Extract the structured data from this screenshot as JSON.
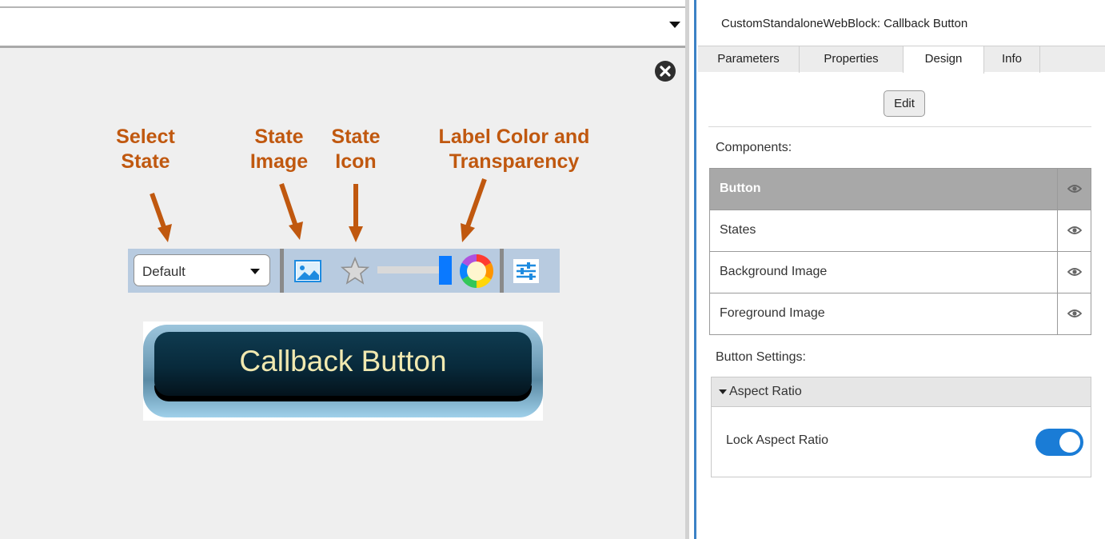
{
  "annotations": {
    "select_state": [
      "Select",
      "State"
    ],
    "state_image": [
      "State",
      "Image"
    ],
    "state_icon": [
      "State",
      "Icon"
    ],
    "label_color": [
      "Label Color and",
      "Transparency"
    ]
  },
  "toolbar": {
    "state_value": "Default",
    "image_icon": "image-icon",
    "star_icon": "star-icon",
    "color_wheel_icon": "color-wheel-icon",
    "settings_icon": "sliders-icon",
    "slider_level": 1.0
  },
  "callback_button": {
    "label": "Callback Button",
    "text_color": "#f1e9b0"
  },
  "panel": {
    "title": "CustomStandaloneWebBlock: Callback Button",
    "tabs": [
      {
        "label": "Parameters",
        "active": false
      },
      {
        "label": "Properties",
        "active": false
      },
      {
        "label": "Design",
        "active": true
      },
      {
        "label": "Info",
        "active": false
      }
    ],
    "edit_label": "Edit",
    "components_label": "Components:",
    "components": [
      {
        "label": "Button",
        "selected": true
      },
      {
        "label": "States",
        "selected": false
      },
      {
        "label": "Background Image",
        "selected": false
      },
      {
        "label": "Foreground Image",
        "selected": false
      }
    ],
    "button_settings_label": "Button Settings:",
    "aspect_ratio_label": "Aspect Ratio",
    "lock_aspect_ratio_label": "Lock Aspect Ratio",
    "lock_aspect_ratio_on": true
  },
  "colors": {
    "annotation": "#c0580f",
    "toolbar_bg": "#b8cbe0",
    "accent_blue": "#1a7cd6"
  }
}
